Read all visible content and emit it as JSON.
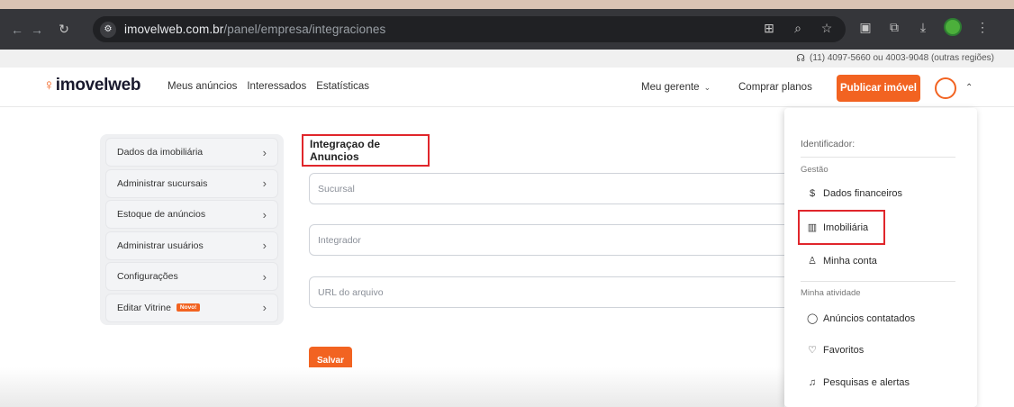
{
  "browser": {
    "url_domain": "imovelweb.com.br",
    "url_path": "/panel/empresa/integraciones",
    "back_icon": "arrow-left-icon",
    "forward_icon": "arrow-right-icon",
    "reload_icon": "reload-icon"
  },
  "phone_strip": {
    "text": "(11) 4097-5660 ou 4003-9048 (outras regiões)"
  },
  "header": {
    "logo_text": "imovelweb",
    "nav": [
      "Meus anúncios",
      "Interessados",
      "Estatísticas"
    ],
    "gerente_label": "Meu gerente",
    "comprar_label": "Comprar planos",
    "publicar_label": "Publicar imóvel"
  },
  "sidebar": {
    "items": [
      {
        "label": "Dados da imobiliária"
      },
      {
        "label": "Administrar sucursais"
      },
      {
        "label": "Estoque de anúncios"
      },
      {
        "label": "Administrar usuários"
      },
      {
        "label": "Configurações"
      },
      {
        "label": "Editar Vitrine",
        "badge": "Novo!"
      }
    ]
  },
  "form": {
    "title": "Integraçao de Anuncios",
    "fields": [
      {
        "placeholder": "Sucursal"
      },
      {
        "placeholder": "Integrador"
      },
      {
        "placeholder": "URL do arquivo"
      }
    ],
    "save_label": "Salvar"
  },
  "dropdown": {
    "identificador": "Identificador:",
    "section_gestao": "Gestão",
    "items_gestao": [
      {
        "label": "Dados financeiros",
        "icon": "dollar-icon"
      },
      {
        "label": "Imobiliária",
        "icon": "building-icon"
      },
      {
        "label": "Minha conta",
        "icon": "user-icon"
      }
    ],
    "section_atividade": "Minha atividade",
    "items_atividade": [
      {
        "label": "Anúncios contatados",
        "icon": "chat-bubble-icon"
      },
      {
        "label": "Favoritos",
        "icon": "heart-icon"
      },
      {
        "label": "Pesquisas e alertas",
        "icon": "bell-icon"
      }
    ]
  },
  "colors": {
    "brand_orange": "#f26321",
    "highlight_red": "#e0262b",
    "browser_bar": "#35363a"
  }
}
